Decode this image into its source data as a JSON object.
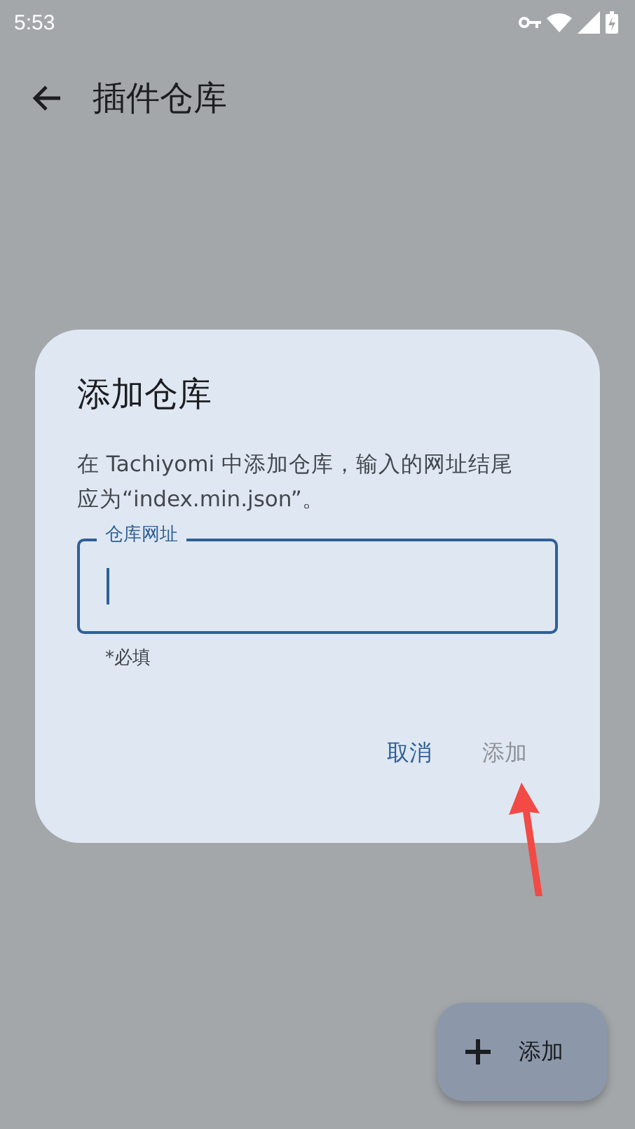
{
  "status_bar": {
    "time": "5:53"
  },
  "app_bar": {
    "title": "插件仓库"
  },
  "dialog": {
    "title": "添加仓库",
    "message": "在 Tachiyomi 中添加仓库，输入的网址结尾应为“index.min.json”。",
    "field": {
      "label": "仓库网址",
      "focused": true
    },
    "helper": "*必填",
    "buttons": [
      {
        "label": "取消",
        "disabled": false
      },
      {
        "label": "添加",
        "disabled": true
      }
    ]
  },
  "fab": {
    "label": "添加"
  },
  "annotation": {
    "kind": "arrow"
  }
}
